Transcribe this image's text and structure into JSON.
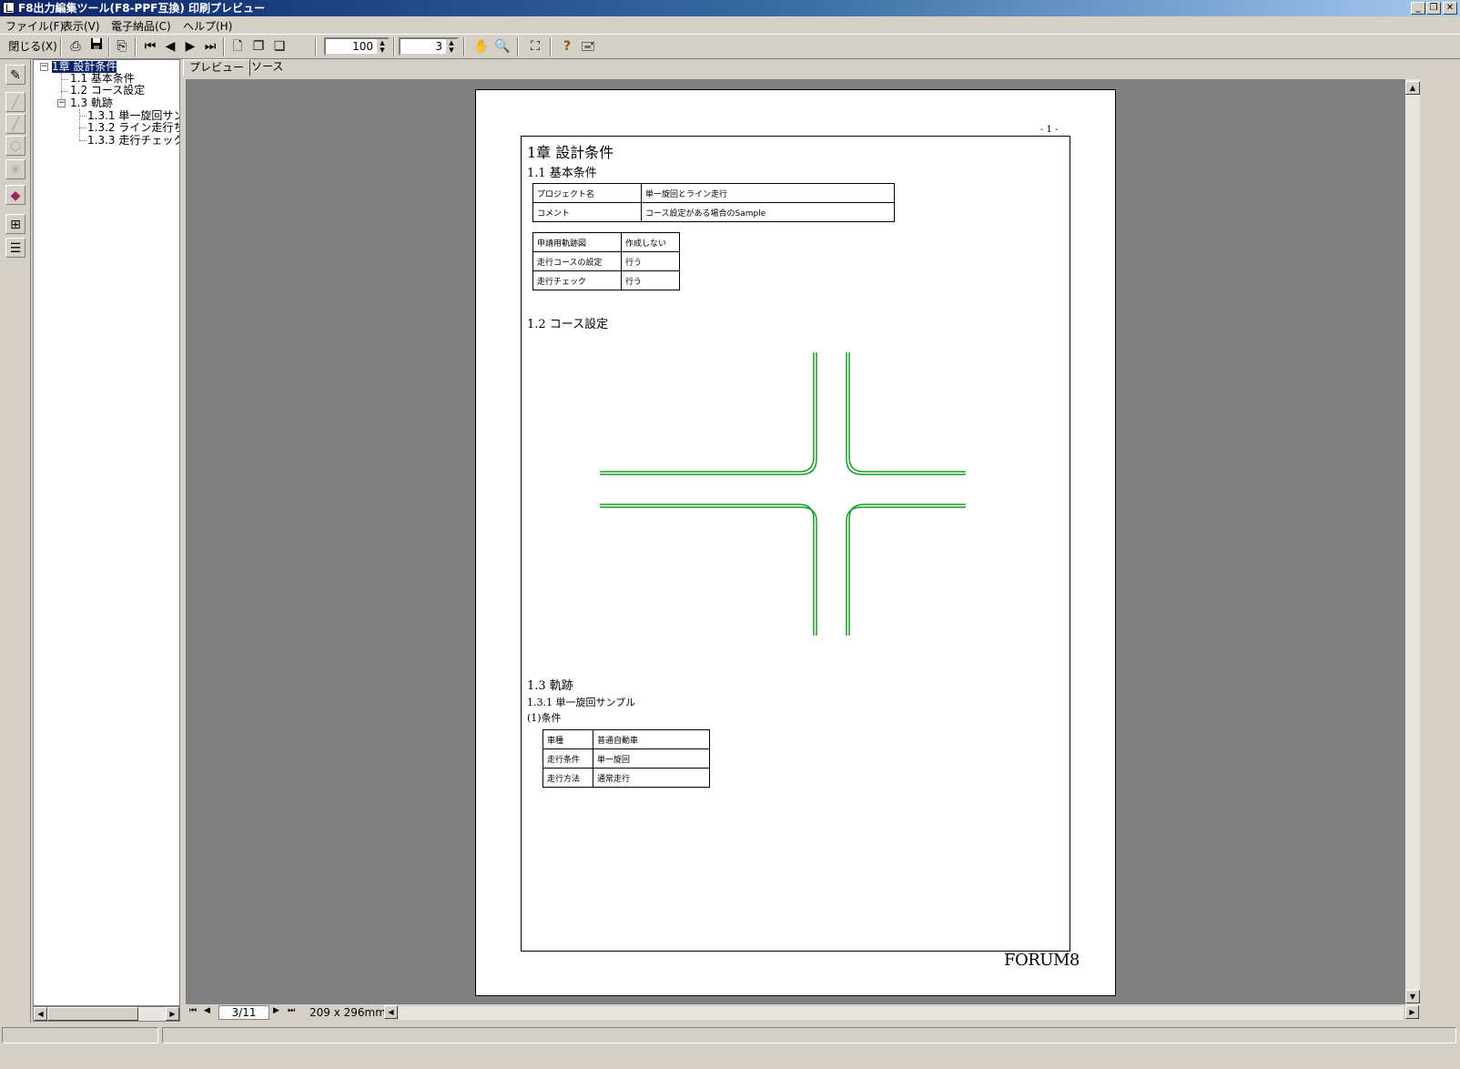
{
  "window": {
    "title": "F8出力編集ツール(F8-PPF互換) 印刷プレビュー",
    "buttons": {
      "minimize": "_",
      "restore": "❐",
      "close": "✕"
    }
  },
  "menu": [
    "ファイル(F)",
    "表示(V)",
    "電子納品(C)",
    "ヘルプ(H)"
  ],
  "toolbar": {
    "close_label": "閉じる(X)",
    "zoom_value": "100",
    "page_count_value": "3"
  },
  "tree": {
    "nodes": [
      {
        "label": "1章 設計条件"
      },
      {
        "label": "1.1 基本条件"
      },
      {
        "label": "1.2 コース設定"
      },
      {
        "label": "1.3 軌跡"
      },
      {
        "label": "1.3.1 単一旋回サン"
      },
      {
        "label": "1.3.2 ライン走行ち"
      },
      {
        "label": "1.3.3 走行チェック"
      }
    ]
  },
  "tabs": [
    "プレビュー",
    "ソース"
  ],
  "page": {
    "page_number": "- 1 -",
    "chapter_title": "1章 設計条件",
    "sec_1_1": "1.1 基本条件",
    "table1": [
      [
        "プロジェクト名",
        "単一旋回とライン走行"
      ],
      [
        "コメント",
        "コース設定がある場合のSample"
      ]
    ],
    "table2": [
      [
        "申請用軌跡図",
        "作成しない"
      ],
      [
        "走行コースの設定",
        "行う"
      ],
      [
        "走行チェック",
        "行う"
      ]
    ],
    "sec_1_2": "1.2 コース設定",
    "sec_1_3": "1.3 軌跡",
    "sec_1_3_1": "1.3.1 単一旋回サンプル",
    "sub_1": "(1)条件",
    "table3": [
      [
        "車種",
        "普通自動車"
      ],
      [
        "走行条件",
        "単一旋回"
      ],
      [
        "走行方法",
        "通常走行"
      ]
    ],
    "footer_logo": "FORUM8",
    "road_color": "#1a9a2a"
  },
  "nav": {
    "page_indicator": "3/11",
    "paper_size": "209 x 296mm"
  }
}
